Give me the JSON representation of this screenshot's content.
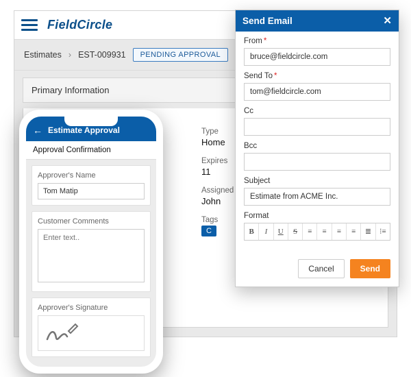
{
  "desktop": {
    "logo": "FieldCircle",
    "breadcrumb": {
      "root": "Estimates",
      "current": "EST-009931"
    },
    "status": "PENDING APPROVAL",
    "section_title": "Primary Information",
    "details": {
      "type_label": "Type",
      "type_value": "Home",
      "expires_label": "Expires",
      "expires_value": "11",
      "assigned_label": "Assigned",
      "assigned_value": "John",
      "tags_label": "Tags",
      "tags_value": "C"
    }
  },
  "modal": {
    "title": "Send Email",
    "from_label": "From",
    "from_value": "bruce@fieldcircle.com",
    "to_label": "Send To",
    "to_value": "tom@fieldcircle.com",
    "cc_label": "Cc",
    "cc_value": "",
    "bcc_label": "Bcc",
    "bcc_value": "",
    "subject_label": "Subject",
    "subject_value": "Estimate from ACME Inc.",
    "format_label": "Format",
    "toolbar": {
      "b": "B",
      "i": "I",
      "u": "U",
      "s": "S",
      "al": "≡",
      "ac": "≡",
      "ar": "≡",
      "aj": "≡",
      "ol": "≣",
      "ul": "⁝≡"
    },
    "cancel": "Cancel",
    "send": "Send"
  },
  "phone": {
    "header_title": "Estimate Approval",
    "subheader": "Approval Confirmation",
    "approver_label": "Approver's Name",
    "approver_value": "Tom Matip",
    "comments_label": "Customer Comments",
    "comments_placeholder": "Enter text..",
    "signature_label": "Approver's Signature"
  }
}
